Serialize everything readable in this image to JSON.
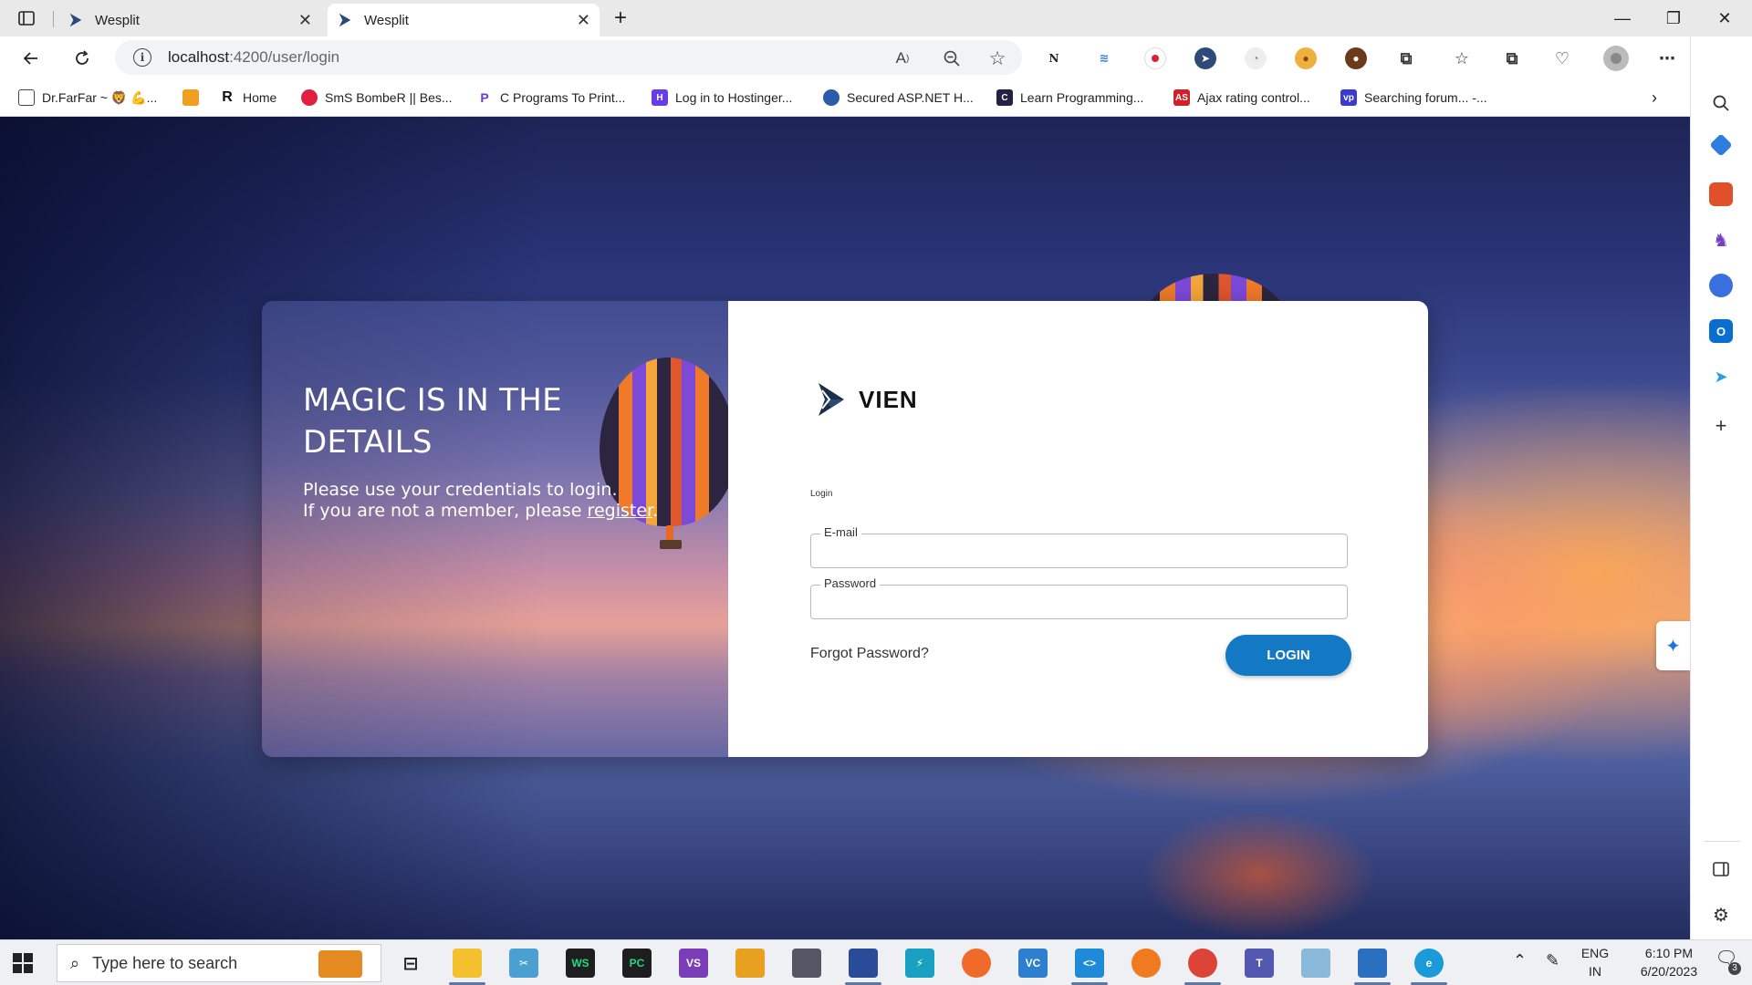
{
  "browser": {
    "tabs": [
      {
        "title": "Wesplit",
        "active": false
      },
      {
        "title": "Wesplit",
        "active": true
      }
    ],
    "new_tab": "+",
    "window_controls": {
      "minimize": "—",
      "restore": "❐",
      "close": "✕"
    },
    "address": {
      "host": "localhost",
      "path": ":4200/user/login"
    },
    "bookmarks": [
      {
        "label": "Dr.FarFar ~ 🦁 💪...",
        "color": "#8b5a2b"
      },
      {
        "label": "",
        "color": "#f0a020"
      },
      {
        "label": "Home",
        "color": "#111111"
      },
      {
        "label": "SmS BombeR || Bes...",
        "color": "#e02040"
      },
      {
        "label": "C Programs To Print...",
        "color": "#6a3be0"
      },
      {
        "label": "Log in to Hostinger...",
        "color": "#673de6"
      },
      {
        "label": "Secured ASP.NET H...",
        "color": "#2a5caa"
      },
      {
        "label": "Learn Programming...",
        "color": "#222244"
      },
      {
        "label": "Ajax rating control...",
        "color": "#d0202a"
      },
      {
        "label": "Searching forum... -...",
        "color": "#3b3bd0"
      }
    ]
  },
  "hero": {
    "title": "MAGIC IS IN THE DETAILS",
    "line1": "Please use your credentials to login.",
    "line2_prefix": "If you are not a member, please ",
    "register_link": "register",
    "line2_suffix": "."
  },
  "login": {
    "brand": "VIEN",
    "heading": "Login",
    "email_label": "E-mail",
    "email_value": "",
    "password_label": "Password",
    "password_value": "",
    "forgot": "Forgot Password?",
    "submit": "LOGIN",
    "brand_color": "#1479c4"
  },
  "taskbar": {
    "search_placeholder": "Type here to search",
    "lang": "ENG",
    "region": "IN",
    "time": "6:10 PM",
    "date": "6/20/2023",
    "notifications": "3"
  }
}
